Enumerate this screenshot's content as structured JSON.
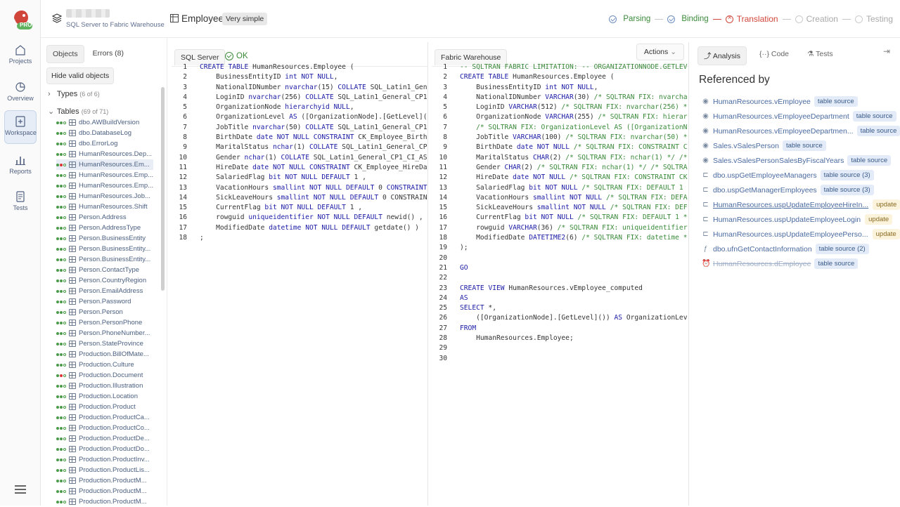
{
  "app": {
    "badge": "PRO"
  },
  "nav": [
    {
      "label": "Projects",
      "icon": "home-icon"
    },
    {
      "label": "Overview",
      "icon": "chart-pie-icon"
    },
    {
      "label": "Workspace",
      "icon": "workspace-icon"
    },
    {
      "label": "Reports",
      "icon": "bar-chart-icon"
    },
    {
      "label": "Tests",
      "icon": "tests-icon"
    }
  ],
  "project": {
    "subtitle": "SQL Server to Fabric Warehouse"
  },
  "object": {
    "name": "Employee",
    "complexity": "Very simple"
  },
  "steps": [
    {
      "label": "Parsing",
      "state": "ok"
    },
    {
      "label": "Binding",
      "state": "ok"
    },
    {
      "label": "Translation",
      "state": "error"
    },
    {
      "label": "Creation",
      "state": "pending"
    },
    {
      "label": "Testing",
      "state": "pending"
    }
  ],
  "objects_panel": {
    "tabs": [
      "Objects",
      "Errors (8)"
    ],
    "hide_button": "Hide valid objects",
    "types": {
      "label": "Types",
      "count": "(6 of 6)"
    },
    "tables": {
      "label": "Tables",
      "count": "(69 of 71)"
    },
    "items": [
      "dbo.AWBuildVersion",
      "dbo.DatabaseLog",
      "dbo.ErrorLog",
      "HumanResources.Dep...",
      "HumanResources.Em...",
      "HumanResources.Emp...",
      "HumanResources.Emp...",
      "HumanResources.Job...",
      "HumanResources.Shift",
      "Person.Address",
      "Person.AddressType",
      "Person.BusinessEntity",
      "Person.BusinessEntity...",
      "Person.BusinessEntity...",
      "Person.ContactType",
      "Person.CountryRegion",
      "Person.EmailAddress",
      "Person.Password",
      "Person.Person",
      "Person.PersonPhone",
      "Person.PhoneNumber...",
      "Person.StateProvince",
      "Production.BillOfMate...",
      "Production.Culture",
      "Production.Document",
      "Production.Illustration",
      "Production.Location",
      "Production.Product",
      "Production.ProductCa...",
      "Production.ProductCo...",
      "Production.ProductDe...",
      "Production.ProductDo...",
      "Production.ProductInv...",
      "Production.ProductLis...",
      "Production.ProductM...",
      "Production.ProductM...",
      "Production.ProductM..."
    ]
  },
  "source": {
    "tab": "SQL Server",
    "status": "OK",
    "lines": [
      "CREATE TABLE HumanResources.Employee (",
      "    BusinessEntityID int NOT NULL,",
      "    NationalIDNumber nvarchar(15) COLLATE SQL_Latin1_Gen",
      "    LoginID nvarchar(256) COLLATE SQL_Latin1_General_CP1",
      "    OrganizationNode hierarchyid NULL,",
      "    OrganizationLevel AS ([OrganizationNode].[GetLevel](",
      "    JobTitle nvarchar(50) COLLATE SQL_Latin1_General_CP1",
      "    BirthDate date NOT NULL CONSTRAINT CK_Employee_Birth",
      "    MaritalStatus nchar(1) COLLATE SQL_Latin1_General_CP",
      "    Gender nchar(1) COLLATE SQL_Latin1_General_CP1_CI_AS",
      "    HireDate date NOT NULL CONSTRAINT CK_Employee_HireDa",
      "    SalariedFlag bit NOT NULL DEFAULT 1 ,",
      "    VacationHours smallint NOT NULL DEFAULT 0 CONSTRAINT",
      "    SickLeaveHours smallint NOT NULL DEFAULT 0 CONSTRAIN",
      "    CurrentFlag bit NOT NULL DEFAULT 1 ,",
      "    rowguid uniqueidentifier NOT NULL DEFAULT newid() ,",
      "    ModifiedDate datetime NOT NULL DEFAULT getdate() )",
      ";"
    ]
  },
  "target": {
    "tab": "Fabric Warehouse",
    "actions": "Actions",
    "lines": [
      "-- SQLTRAN FABRIC LIMITATION: -- ORGANIZATIONNODE.GETLEV",
      "CREATE TABLE HumanResources.Employee (",
      "    BusinessEntityID int NOT NULL,",
      "    NationalIDNumber VARCHAR(30) /* SQLTRAN FIX: nvarcha",
      "    LoginID VARCHAR(512) /* SQLTRAN FIX: nvarchar(256) *",
      "    OrganizationNode VARCHAR(255) /* SQLTRAN FIX: hierar",
      "    /* SQLTRAN FIX: OrganizationLevel AS ([OrganizationN",
      "    JobTitle VARCHAR(100) /* SQLTRAN FIX: nvarchar(50) *",
      "    BirthDate date NOT NULL /* SQLTRAN FIX: CONSTRAINT C",
      "    MaritalStatus CHAR(2) /* SQLTRAN FIX: nchar(1) */ /*",
      "    Gender CHAR(2) /* SQLTRAN FIX: nchar(1) */ /* SQLTRA",
      "    HireDate date NOT NULL /* SQLTRAN FIX: CONSTRAINT CK",
      "    SalariedFlag bit NOT NULL /* SQLTRAN FIX: DEFAULT 1",
      "    VacationHours smallint NOT NULL /* SQLTRAN FIX: DEFA",
      "    SickLeaveHours smallint NOT NULL /* SQLTRAN FIX: DEF",
      "    CurrentFlag bit NOT NULL /* SQLTRAN FIX: DEFAULT 1 *",
      "    rowguid VARCHAR(36) /* SQLTRAN FIX: uniqueidentifier",
      "    ModifiedDate DATETIME2(6) /* SQLTRAN FIX: datetime *",
      ");",
      "",
      "GO",
      "",
      "CREATE VIEW HumanResources.vEmployee_computed",
      "AS",
      "SELECT *,",
      "    ([OrganizationNode].[GetLevel]()) AS OrganizationLev",
      "FROM",
      "    HumanResources.Employee;",
      "",
      ""
    ]
  },
  "analysis": {
    "tabs": [
      "Analysis",
      "Code",
      "Tests"
    ],
    "title": "Referenced by",
    "refs": [
      {
        "name": "HumanResources.vEmployee",
        "tag": "table source",
        "kind": "view"
      },
      {
        "name": "HumanResources.vEmployeeDepartment",
        "tag": "table source",
        "kind": "view"
      },
      {
        "name": "HumanResources.vEmployeeDepartmen...",
        "tag": "table source",
        "kind": "view"
      },
      {
        "name": "Sales.vSalesPerson",
        "tag": "table source",
        "kind": "view"
      },
      {
        "name": "Sales.vSalesPersonSalesByFiscalYears",
        "tag": "table source",
        "kind": "view"
      },
      {
        "name": "dbo.uspGetEmployeeManagers",
        "tag": "table source (3)",
        "kind": "proc"
      },
      {
        "name": "dbo.uspGetManagerEmployees",
        "tag": "table source (3)",
        "kind": "proc"
      },
      {
        "name": "HumanResources.uspUpdateEmployeeHireIn...",
        "tag": "update",
        "kind": "proc-u"
      },
      {
        "name": "HumanResources.uspUpdateEmployeeLogin",
        "tag": "update",
        "kind": "proc-y"
      },
      {
        "name": "HumanResources.uspUpdateEmployeePerso...",
        "tag": "update",
        "kind": "proc-y"
      },
      {
        "name": "dbo.ufnGetContactInformation",
        "tag": "table source (2)",
        "kind": "func"
      },
      {
        "name": "HumanResources.dEmployee",
        "tag": "table source",
        "kind": "trigger"
      }
    ]
  }
}
